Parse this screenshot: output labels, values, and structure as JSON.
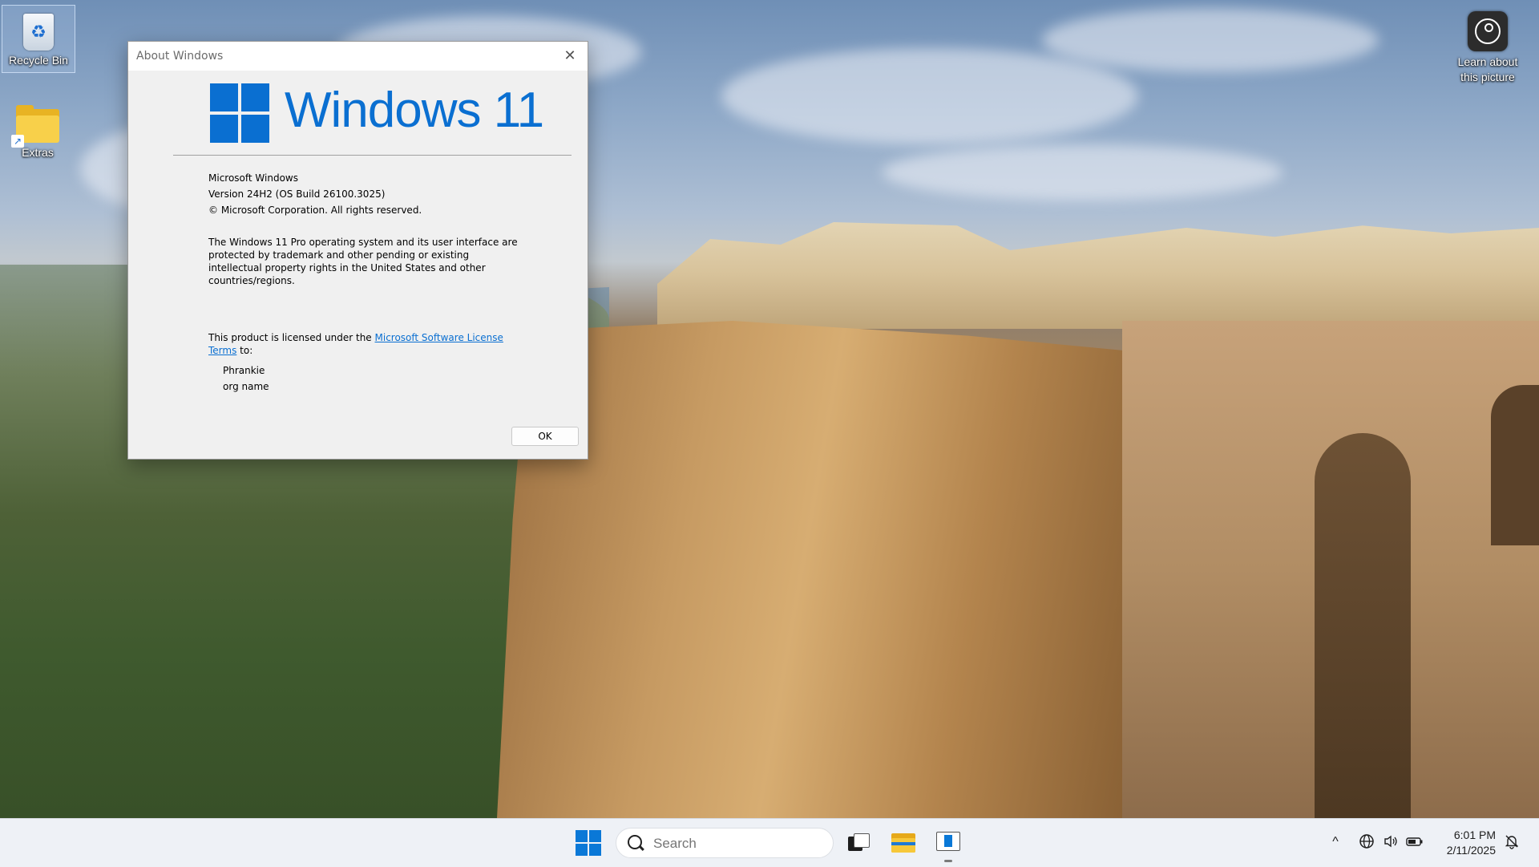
{
  "desktop": {
    "icons": [
      {
        "label": "Recycle Bin",
        "icon": "recycle-bin-icon"
      },
      {
        "label": "Extras",
        "icon": "folder-shortcut-icon"
      },
      {
        "label": "Learn about this picture",
        "icon": "learn-about-picture-icon"
      }
    ]
  },
  "dialog": {
    "title": "About Windows",
    "close_glyph": "✕",
    "logo_text": "Windows 11",
    "product": "Microsoft Windows",
    "version": "Version 24H2 (OS Build 26100.3025)",
    "copyright": "© Microsoft Corporation. All rights reserved.",
    "description": "The Windows 11 Pro operating system and its user interface are protected by trademark and other pending or existing intellectual property rights in the United States and other countries/regions.",
    "license_prefix": "This product is licensed under the ",
    "license_link": "Microsoft Software License Terms",
    "license_suffix": " to:",
    "licensed_user": "Phrankie",
    "licensed_org": "org name",
    "ok_label": "OK"
  },
  "taskbar": {
    "search_placeholder": "Search",
    "tray": {
      "chevron": "^",
      "network_icon": "globe-icon",
      "volume_icon": "speaker-icon",
      "battery_icon": "battery-icon",
      "notification_icon": "notification-bell-icon"
    },
    "time": "6:01 PM",
    "date": "2/11/2025"
  },
  "colors": {
    "accent": "#0a6fd1",
    "taskbar_bg": "#eef1f6",
    "dialog_bg": "#f0f0f0"
  }
}
